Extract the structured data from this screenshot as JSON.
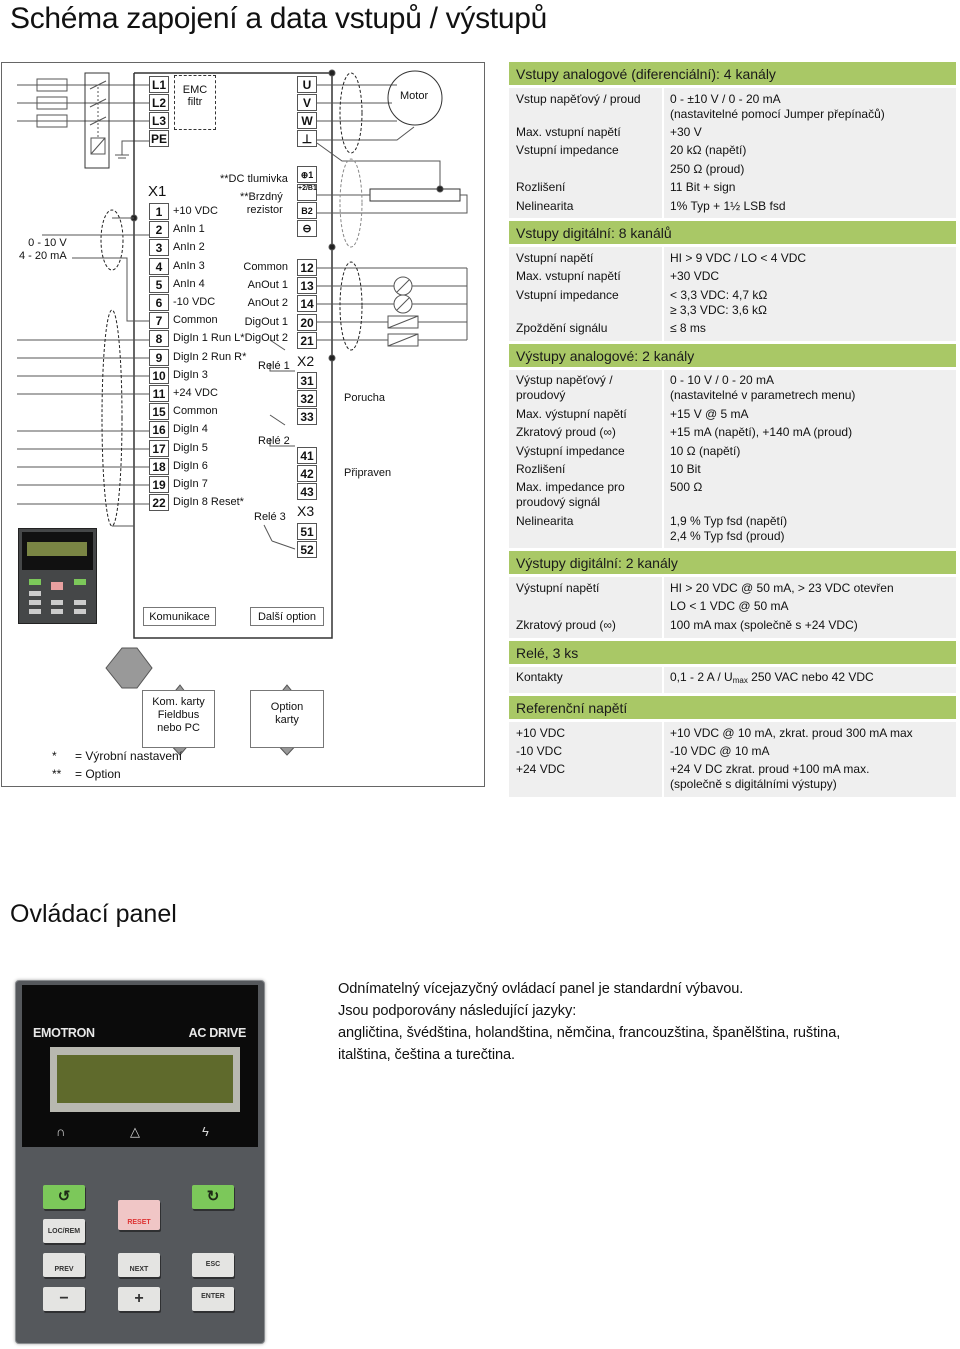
{
  "page": {
    "title": "Schéma zapojení a data vstupů / výstupů",
    "section2_title": "Ovládací panel"
  },
  "diagram": {
    "emc_filter": "EMC\nfiltr",
    "motor": "Motor",
    "power_terminals": [
      "L1",
      "L2",
      "L3",
      "PE"
    ],
    "motor_terminals": [
      "U",
      "V",
      "W",
      "⊥"
    ],
    "dc_terminals": [
      "⊕1",
      "+2/B1",
      "B2",
      "⊖"
    ],
    "dc_choke_label": "**DC tlumivka",
    "brake_resistor_label": "**Brzdný\nrezistor",
    "analog_input_source": "0 - 10 V\n4 - 20 mA",
    "x1_label": "X1",
    "x2_label": "X2",
    "x3_label": "X3",
    "x1_terminals": [
      {
        "num": "1",
        "label": "+10 VDC"
      },
      {
        "num": "2",
        "label": "AnIn 1"
      },
      {
        "num": "3",
        "label": "AnIn 2"
      },
      {
        "num": "4",
        "label": "AnIn 3"
      },
      {
        "num": "5",
        "label": "AnIn 4"
      },
      {
        "num": "6",
        "label": "-10 VDC"
      },
      {
        "num": "7",
        "label": "Common"
      },
      {
        "num": "8",
        "label": "DigIn 1 Run L*"
      },
      {
        "num": "9",
        "label": "DigIn 2 Run R*"
      },
      {
        "num": "10",
        "label": "DigIn 3"
      },
      {
        "num": "11",
        "label": "+24 VDC"
      },
      {
        "num": "15",
        "label": "Common"
      },
      {
        "num": "16",
        "label": "DigIn 4"
      },
      {
        "num": "17",
        "label": "DigIn 5"
      },
      {
        "num": "18",
        "label": "DigIn 6"
      },
      {
        "num": "19",
        "label": "DigIn 7"
      },
      {
        "num": "22",
        "label": "DigIn 8 Reset*"
      }
    ],
    "output_terminals": [
      {
        "num": "12",
        "label": "Common"
      },
      {
        "num": "13",
        "label": "AnOut 1"
      },
      {
        "num": "14",
        "label": "AnOut 2"
      },
      {
        "num": "20",
        "label": "DigOut 1"
      },
      {
        "num": "21",
        "label": "DigOut 2"
      }
    ],
    "relays": [
      {
        "label": "Relé 1",
        "terminals": [
          "31",
          "32",
          "33"
        ],
        "function": "Porucha"
      },
      {
        "label": "Relé 2",
        "terminals": [
          "41",
          "42",
          "43"
        ],
        "function": "Připraven"
      },
      {
        "label": "Relé 3",
        "terminals": [
          "51",
          "52"
        ],
        "function": ""
      }
    ],
    "communication": "Komunikace",
    "other_option": "Další option",
    "comm_cards": "Kom. karty\nFieldbus\nnebo PC",
    "option_cards": "Option\nkarty",
    "footnotes": [
      {
        "mark": "*",
        "text": "= Výrobní nastavení"
      },
      {
        "mark": "**",
        "text": "= Option"
      }
    ]
  },
  "spec_sections": [
    {
      "title": "Vstupy analogové (diferenciální): 4 kanály",
      "rows": [
        {
          "k": "Vstup napěťový / proud",
          "v": "0 - ±10 V / 0 - 20 mA\n(nastavitelné pomocí Jumper přepínačů)"
        },
        {
          "k": "Max. vstupní napětí",
          "v": "+30 V"
        },
        {
          "k": "Vstupní impedance",
          "v": "20 kΩ (napětí)"
        },
        {
          "k": "",
          "v": "250 Ω (proud)"
        },
        {
          "k": "Rozlišení",
          "v": "11 Bit + sign"
        },
        {
          "k": "Nelinearita",
          "v": "1% Typ + 1½ LSB fsd"
        }
      ]
    },
    {
      "title": "Vstupy digitální: 8 kanálů",
      "rows": [
        {
          "k": "Vstupní napětí",
          "v": "HI > 9 VDC / LO < 4 VDC"
        },
        {
          "k": "Max. vstupní napětí",
          "v": "+30 VDC"
        },
        {
          "k": "Vstupní impedance",
          "v": "< 3,3 VDC: 4,7 kΩ\n≥ 3,3 VDC: 3,6 kΩ"
        },
        {
          "k": "Zpoždění signálu",
          "v": "≤ 8 ms"
        }
      ]
    },
    {
      "title": "Výstupy analogové: 2 kanály",
      "rows": [
        {
          "k": "Výstup napěťový /\nproudový",
          "v": "0 - 10 V / 0 - 20 mA\n(nastavitelné v parametrech menu)"
        },
        {
          "k": "Max. výstupní napětí",
          "v": "+15 V @ 5 mA"
        },
        {
          "k": "Zkratový proud (∞)",
          "v": "+15 mA (napětí), +140 mA (proud)"
        },
        {
          "k": "Výstupní impedance",
          "v": "10 Ω (napětí)"
        },
        {
          "k": "Rozlišení",
          "v": "10 Bit"
        },
        {
          "k": "Max. impedance pro\nproudový signál",
          "v": "500 Ω"
        },
        {
          "k": "Nelinearita",
          "v": "1,9 % Typ fsd (napětí)\n2,4 % Typ fsd (proud)"
        }
      ]
    },
    {
      "title": "Výstupy digitální: 2 kanály",
      "rows": [
        {
          "k": "Výstupní napětí",
          "v": "HI > 20 VDC @ 50 mA, > 23 VDC otevřen"
        },
        {
          "k": "",
          "v": "LO < 1 VDC @ 50 mA"
        },
        {
          "k": "Zkratový proud (∞)",
          "v": "100 mA max (společně s +24 VDC)"
        }
      ]
    },
    {
      "title": "Relé, 3 ks",
      "rows": [
        {
          "k": "Kontakty",
          "v": "0,1 - 2 A / U",
          "sub": "max",
          "v2": " 250 VAC nebo 42 VDC"
        }
      ]
    },
    {
      "title": "Referenční napětí",
      "rows": [
        {
          "k": "+10 VDC",
          "v": "+10 VDC @ 10 mA, zkrat. proud 300 mA max"
        },
        {
          "k": "-10 VDC",
          "v": "-10 VDC @ 10 mA"
        },
        {
          "k": "+24 VDC",
          "v": "+24 V DC zkrat. proud +100 mA max.\n(společně s digitálními výstupy)"
        }
      ]
    }
  ],
  "panel": {
    "brand_left": "EMOTRON",
    "brand_right": "AC DRIVE",
    "indicators": [
      "run-icon",
      "trip-icon",
      "power-icon"
    ],
    "keys": {
      "run_left": "↺",
      "run_right": "↻",
      "stop_reset": "RESET",
      "loc_rem": "LOC/REM",
      "prev": "PREV",
      "next": "NEXT",
      "esc": "ESC",
      "minus": "−",
      "plus": "+",
      "enter": "ENTER"
    },
    "colors": {
      "run_key": "#7cc85a",
      "stop_key": "#f0c6c6",
      "lcd": "#5f6a2c"
    }
  },
  "panel_description": [
    "Odnímatelný vícejazyčný ovládací panel je standardní výbavou.",
    "Jsou podporovány následující jazyky:",
    "angličtina, švédština, holandština, němčina, francouzština, španělština, ruština,",
    "italština, čeština a turečtina."
  ],
  "colors": {
    "section_header": "#a9c866",
    "section_body": "#efefef"
  }
}
